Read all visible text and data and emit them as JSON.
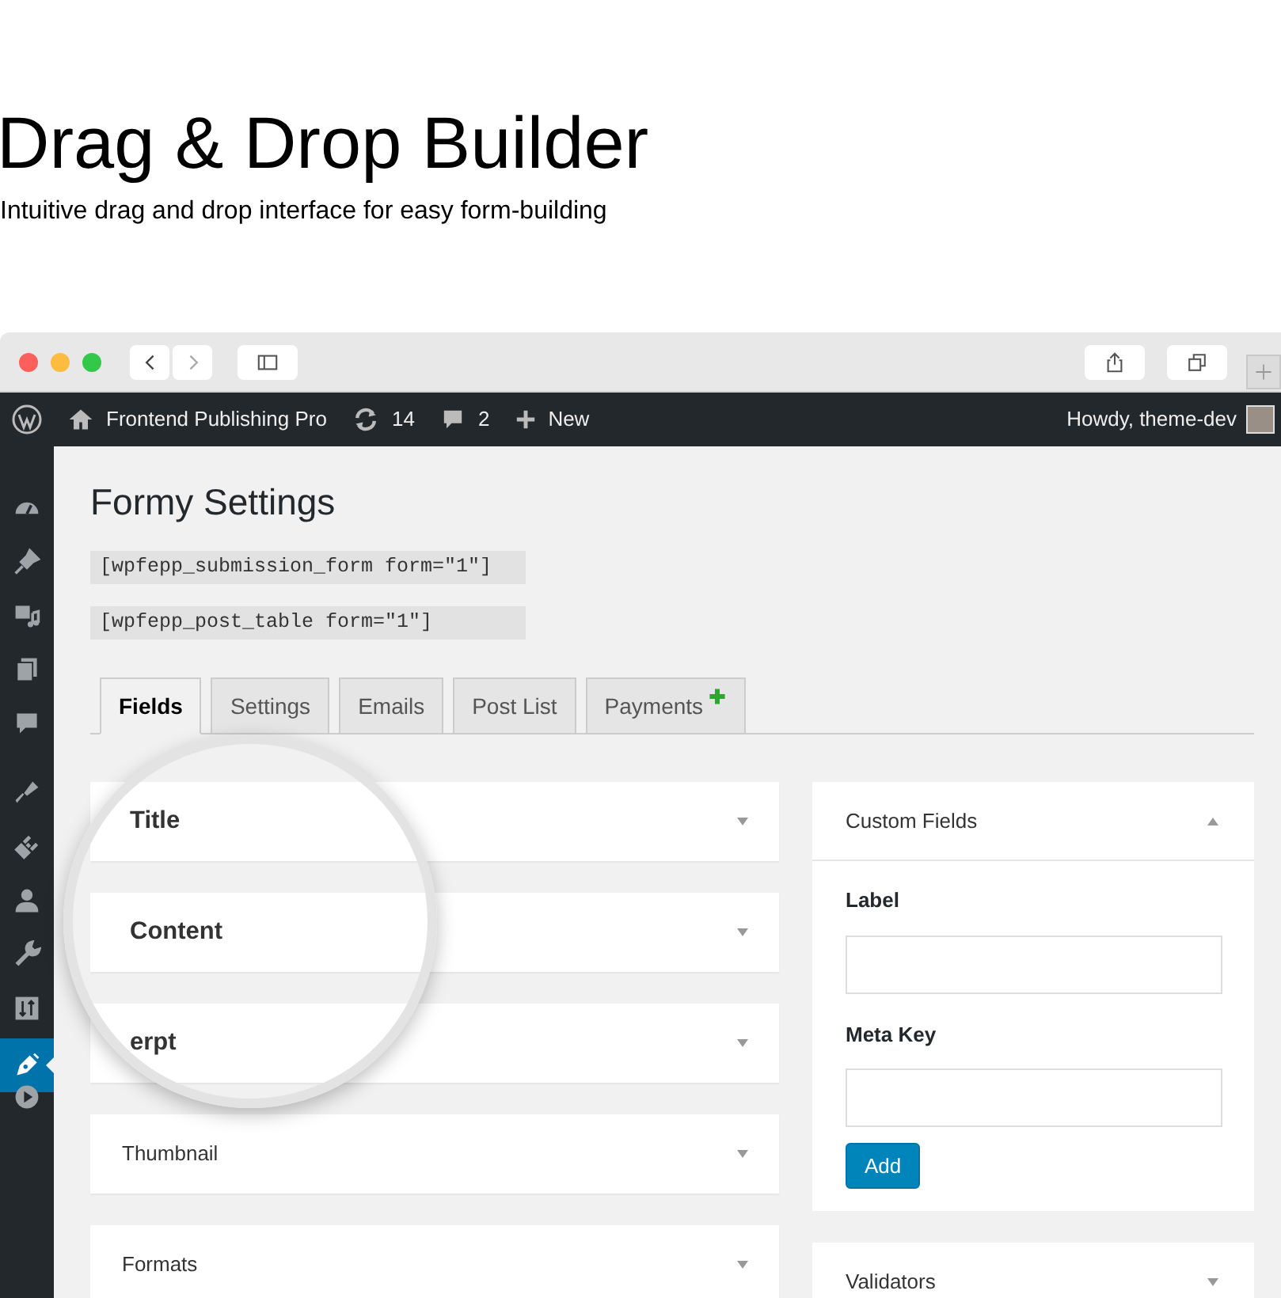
{
  "hero": {
    "title": "Drag & Drop Builder",
    "subtitle": "Intuitive drag and drop interface for easy form-building"
  },
  "admin_bar": {
    "site": "Frontend Publishing Pro",
    "updates": "14",
    "comments": "2",
    "new": "New",
    "greeting": "Howdy, theme-dev"
  },
  "sidebar": {
    "items": [
      {
        "kind": "dashboard",
        "selected": false
      },
      {
        "kind": "pin",
        "selected": false
      },
      {
        "kind": "media",
        "selected": false
      },
      {
        "kind": "pages",
        "selected": false
      },
      {
        "kind": "comments",
        "selected": false
      },
      {
        "kind": "brush",
        "selected": false
      },
      {
        "kind": "plug",
        "selected": false
      },
      {
        "kind": "user",
        "selected": false
      },
      {
        "kind": "wrench",
        "selected": false
      },
      {
        "kind": "sliders",
        "selected": false
      },
      {
        "kind": "pen",
        "selected": true
      },
      {
        "kind": "play",
        "selected": false
      }
    ]
  },
  "page": {
    "title": "Formy Settings",
    "shortcodes": [
      "[wpfepp_submission_form form=\"1\"]",
      "[wpfepp_post_table form=\"1\"]"
    ]
  },
  "tabs": [
    {
      "label": "Fields",
      "selected": true,
      "plus": false
    },
    {
      "label": "Settings",
      "selected": false,
      "plus": false
    },
    {
      "label": "Emails",
      "selected": false,
      "plus": false
    },
    {
      "label": "Post List",
      "selected": false,
      "plus": false
    },
    {
      "label": "Payments",
      "selected": false,
      "plus": true
    }
  ],
  "fields": [
    {
      "label": "Title",
      "magnified": true
    },
    {
      "label": "Content",
      "magnified": true
    },
    {
      "label": "erpt",
      "magnified": true
    },
    {
      "label": "Thumbnail",
      "magnified": false
    },
    {
      "label": "Formats",
      "magnified": false
    }
  ],
  "custom_fields": {
    "title": "Custom Fields",
    "expanded": true,
    "inputs": [
      {
        "label": "Label"
      },
      {
        "label": "Meta Key"
      }
    ],
    "button": "Add"
  },
  "validators": {
    "title": "Validators",
    "expanded": false
  }
}
